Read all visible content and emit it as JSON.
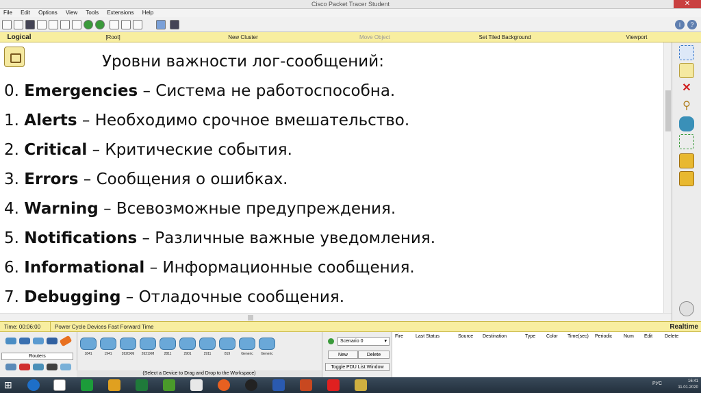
{
  "window": {
    "title": "Cisco Packet Tracer Student"
  },
  "menu": [
    "File",
    "Edit",
    "Options",
    "View",
    "Tools",
    "Extensions",
    "Help"
  ],
  "workspace_bar": {
    "logical": "Logical",
    "root": "[Root]",
    "new_cluster": "New Cluster",
    "move_object": "Move Object",
    "tiled_bg": "Set Tiled Background",
    "viewport": "Viewport"
  },
  "slide": {
    "heading": "Уровни важности лог-сообщений:",
    "items": [
      {
        "num": "0.",
        "term": "Emergencies",
        "desc": " – Система не работоспособна."
      },
      {
        "num": "1.",
        "term": "Alerts",
        "desc": " – Необходимо срочное вмешательство."
      },
      {
        "num": "2.",
        "term": "Critical",
        "desc": " – Критические события."
      },
      {
        "num": "3.",
        "term": "Errors",
        "desc": " – Сообщения о ошибках."
      },
      {
        "num": "4.",
        "term": "Warning",
        "desc": " – Всевозможные предупреждения."
      },
      {
        "num": "5.",
        "term": "Notifications",
        "desc": " – Различные важные уведомления."
      },
      {
        "num": "6.",
        "term": "Informational",
        "desc": " – Информационные сообщения."
      },
      {
        "num": "7.",
        "term": "Debugging",
        "desc": " – Отладочные сообщения."
      }
    ]
  },
  "timebar": {
    "time": "Time: 00:06:00",
    "power_cycle": "Power Cycle Devices  Fast Forward Time",
    "mode": "Realtime"
  },
  "devices": {
    "category": "Routers",
    "hint": "(Select a Device to Drag and Drop to the Workspace)",
    "items": [
      "1841",
      "1941",
      "2620XM",
      "2621XM",
      "2811",
      "2901",
      "2911",
      "819",
      "Generic",
      "Generic"
    ]
  },
  "scenario": {
    "selected": "Scenario 0",
    "new": "New",
    "delete": "Delete",
    "toggle": "Toggle PDU List Window"
  },
  "pdu_columns": [
    "Fire",
    "Last Status",
    "Source",
    "Destination",
    "Type",
    "Color",
    "Time(sec)",
    "Periodic",
    "Num",
    "Edit",
    "Delete"
  ],
  "tray": {
    "lang": "РУС",
    "time": "16:41",
    "date": "11.01.2020"
  }
}
